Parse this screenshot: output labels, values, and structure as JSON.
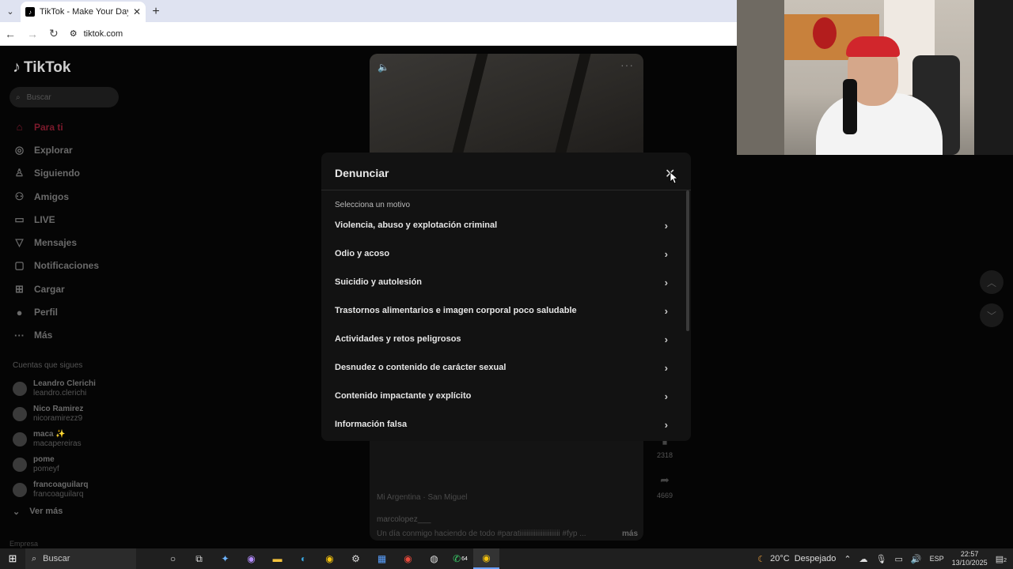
{
  "browser": {
    "tab_title": "TikTok - Make Your Day",
    "url": "tiktok.com"
  },
  "sidebar": {
    "logo": "TikTok",
    "search_placeholder": "Buscar",
    "nav": [
      {
        "label": "Para ti",
        "icon": "home-icon"
      },
      {
        "label": "Explorar",
        "icon": "compass-icon"
      },
      {
        "label": "Siguiendo",
        "icon": "user-follow-icon"
      },
      {
        "label": "Amigos",
        "icon": "friends-icon"
      },
      {
        "label": "LIVE",
        "icon": "live-icon"
      },
      {
        "label": "Mensajes",
        "icon": "send-icon"
      },
      {
        "label": "Notificaciones",
        "icon": "inbox-icon"
      },
      {
        "label": "Cargar",
        "icon": "plus-box-icon"
      },
      {
        "label": "Perfil",
        "icon": "avatar-icon"
      },
      {
        "label": "Más",
        "icon": "more-icon"
      }
    ],
    "following_title": "Cuentas que sigues",
    "following": [
      {
        "name": "Leandro Clerichi",
        "handle": "leandro.clerichi"
      },
      {
        "name": "Nico Ramirez",
        "handle": "nicoramirezz9"
      },
      {
        "name": "maca ✨",
        "handle": "macapereiras"
      },
      {
        "name": "pome",
        "handle": "pomeyf"
      },
      {
        "name": "francoaguilarq",
        "handle": "francoaguilarq"
      }
    ],
    "see_more": "Ver más",
    "footer": "Empresa"
  },
  "video": {
    "location": "Mi Argentina · San Miguel",
    "username": "marcolopez___",
    "caption": "Un día conmigo haciendo de todo #paratiiiiiiiiiiiiiiiiiiiiiii #fyp ...",
    "more": "más",
    "saves": "2318",
    "shares": "4669"
  },
  "modal": {
    "title": "Denunciar",
    "subtitle": "Selecciona un motivo",
    "reasons": [
      "Violencia, abuso y explotación criminal",
      "Odio y acoso",
      "Suicidio y autolesión",
      "Trastornos alimentarios e imagen corporal poco saludable",
      "Actividades y retos peligrosos",
      "Desnudez o contenido de carácter sexual",
      "Contenido impactante y explícito",
      "Información falsa"
    ]
  },
  "taskbar": {
    "search": "Buscar",
    "temperature": "20°C",
    "weather": "Despejado",
    "lang": "ESP",
    "time": "22:57",
    "date": "13/10/2025",
    "whatsapp_badge": "64",
    "notif_badge": "2"
  },
  "colors": {
    "accent": "#fe2c55",
    "modal_bg": "#121212"
  }
}
